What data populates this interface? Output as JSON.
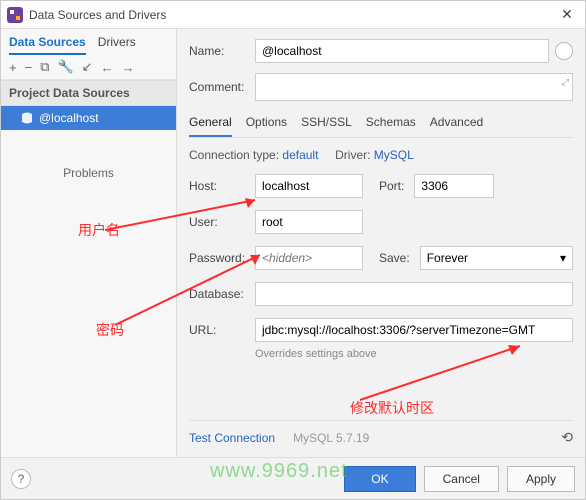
{
  "title": "Data Sources and Drivers",
  "left": {
    "tabs": [
      "Data Sources",
      "Drivers"
    ],
    "section_header": "Project Data Sources",
    "datasource": "@localhost",
    "problems": "Problems"
  },
  "form": {
    "name_label": "Name:",
    "name_value": "@localhost",
    "comment_label": "Comment:"
  },
  "tabs": [
    "General",
    "Options",
    "SSH/SSL",
    "Schemas",
    "Advanced"
  ],
  "conn": {
    "type_label": "Connection type:",
    "type_value": "default",
    "driver_label": "Driver:",
    "driver_value": "MySQL"
  },
  "fields": {
    "host_label": "Host:",
    "host_value": "localhost",
    "port_label": "Port:",
    "port_value": "3306",
    "user_label": "User:",
    "user_value": "root",
    "password_label": "Password:",
    "password_placeholder": "<hidden>",
    "save_label": "Save:",
    "save_value": "Forever",
    "database_label": "Database:",
    "database_value": "",
    "url_label": "URL:",
    "url_value": "jdbc:mysql://localhost:3306/?serverTimezone=GMT",
    "override_note": "Overrides settings above"
  },
  "test": {
    "link": "Test Connection",
    "version": "MySQL 5.7.19"
  },
  "footer": {
    "ok": "OK",
    "cancel": "Cancel",
    "apply": "Apply"
  },
  "annotations": {
    "user": "用户名",
    "password": "密码",
    "timezone": "修改默认时区",
    "watermark": "www.9969.net"
  }
}
